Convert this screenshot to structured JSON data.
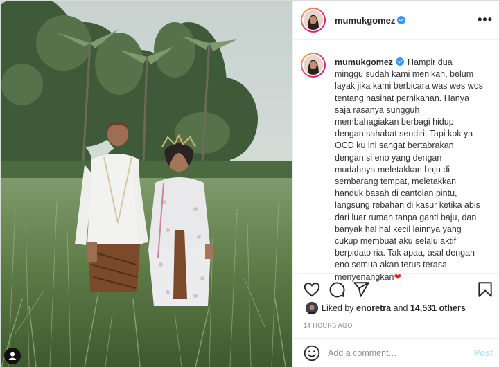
{
  "post": {
    "username": "mumukgomez",
    "verified": true,
    "more_label": "•••",
    "caption_lines": [
      "Hampir dua",
      "minggu sudah kami menikah, belum",
      "layak jika kami berbicara was wes wos",
      "tentang nasihat pernikahan. Hanya",
      "saja rasanya sungguh",
      "membahagiakan berbagi hidup",
      "dengan sahabat sendiri. Tapi kok ya",
      "OCD ku ini sangat bertabrakan",
      "dengan si eno yang dengan",
      "mudahnya meletakkan baju di",
      "sembarang tempat, meletakkan",
      "handuk basah di cantolan pintu,",
      "langsung rebahan di kasur ketika abis",
      "dari luar rumah tanpa ganti baju, dan",
      "banyak hal hal kecil lainnya yang",
      "cukup membuat aku selalu aktif",
      "berpidato ria. Tak apaa, asal dengan",
      "eno semua akan terus terasa",
      "menyenangkan"
    ],
    "heart_emoji": "❤",
    "likes": {
      "prefix": "Liked by ",
      "user": "enoretra",
      "middle": " and ",
      "count": "14,531 others"
    },
    "time_ago": "14 HOURS AGO"
  },
  "comment": {
    "placeholder": "Add a comment…",
    "post_label": "Post"
  },
  "icons": {
    "like": "heart-outline-icon",
    "comment": "comment-bubble-icon",
    "share": "paper-plane-icon",
    "save": "bookmark-icon",
    "emoji": "smiley-icon",
    "tag": "user-tag-icon"
  },
  "colors": {
    "verified": "#3897f0",
    "heart": "#ed1c24",
    "post_button": "#b2dffc",
    "muted": "#8e8e8e"
  }
}
